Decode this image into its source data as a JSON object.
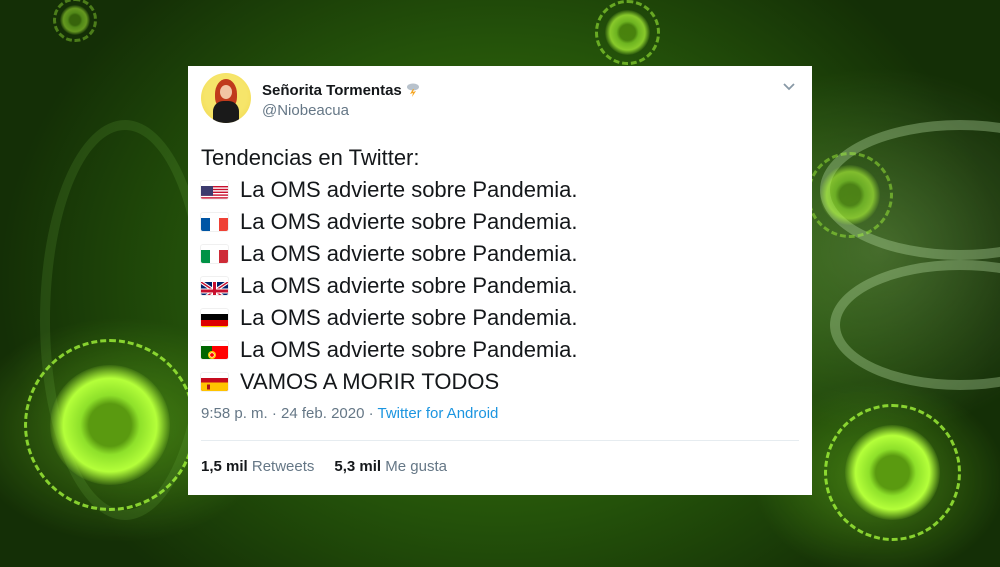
{
  "tweet": {
    "display_name": "Señorita Tormentas",
    "name_emoji_icon": "storm-cloud-icon",
    "handle": "@Niobeacua",
    "intro": "Tendencias en Twitter:",
    "lines": [
      {
        "flag": "us-flag-icon",
        "text": "La OMS advierte sobre Pandemia."
      },
      {
        "flag": "fr-flag-icon",
        "text": "La OMS advierte sobre Pandemia."
      },
      {
        "flag": "it-flag-icon",
        "text": "La OMS advierte sobre Pandemia."
      },
      {
        "flag": "gb-flag-icon",
        "text": "La OMS advierte sobre Pandemia."
      },
      {
        "flag": "de-flag-icon",
        "text": "La OMS advierte sobre Pandemia."
      },
      {
        "flag": "pt-flag-icon",
        "text": "La OMS advierte sobre Pandemia."
      },
      {
        "flag": "es-flag-icon",
        "text": "VAMOS A MORIR TODOS"
      }
    ],
    "time_date": "9:58 p. m. · 24 feb. 2020 · ",
    "source": "Twitter for Android",
    "retweets_count": "1,5 mil",
    "retweets_label": "Retweets",
    "likes_count": "5,3 mil",
    "likes_label": "Me gusta"
  },
  "colors": {
    "link": "#1b95e0",
    "secondary_text": "#657786",
    "primary_text": "#14171a",
    "background_green": "#3f7d10"
  }
}
